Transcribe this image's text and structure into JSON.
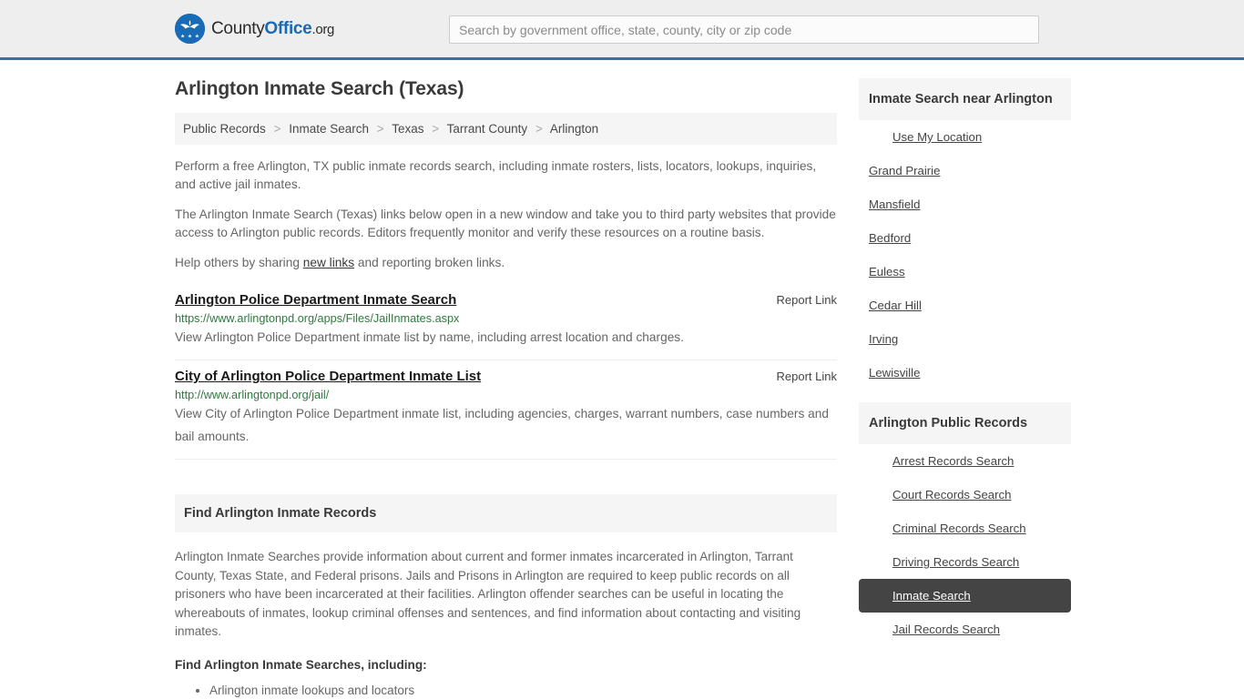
{
  "header": {
    "logo": {
      "icon": "eagle-seal-icon",
      "part1": "County",
      "part2": "Office",
      "part3": ".org"
    },
    "search": {
      "placeholder": "Search by government office, state, county, city or zip code",
      "value": "",
      "icon": "search-icon"
    },
    "accent_color": "#3a6ea5"
  },
  "main": {
    "title": "Arlington Inmate Search (Texas)",
    "breadcrumb": {
      "separator": ">",
      "items": [
        {
          "label": "Public Records"
        },
        {
          "label": "Inmate Search"
        },
        {
          "label": "Texas"
        },
        {
          "label": "Tarrant County"
        },
        {
          "label": "Arlington"
        }
      ]
    },
    "intro": {
      "p1": "Perform a free Arlington, TX public inmate records search, including inmate rosters, lists, locators, lookups, inquiries, and active jail inmates.",
      "p2": "The Arlington Inmate Search (Texas) links below open in a new window and take you to third party websites that provide access to Arlington public records. Editors frequently monitor and verify these resources on a routine basis.",
      "p3_before": "Help others by sharing ",
      "p3_link": "new links",
      "p3_after": " and reporting broken links."
    },
    "results": [
      {
        "title": "Arlington Police Department Inmate Search",
        "report_label": "Report Link",
        "url": "https://www.arlingtonpd.org/apps/Files/JailInmates.aspx",
        "description": "View Arlington Police Department inmate list by name, including arrest location and charges."
      },
      {
        "title": "City of Arlington Police Department Inmate List",
        "report_label": "Report Link",
        "url": "http://www.arlingtonpd.org/jail/",
        "description": "View City of Arlington Police Department inmate list, including agencies, charges, warrant numbers, case numbers and bail amounts."
      }
    ],
    "section": {
      "heading": "Find Arlington Inmate Records",
      "body": "Arlington Inmate Searches provide information about current and former inmates incarcerated in Arlington, Tarrant County, Texas State, and Federal prisons. Jails and Prisons in Arlington are required to keep public records on all prisoners who have been incarcerated at their facilities. Arlington offender searches can be useful in locating the whereabouts of inmates, lookup criminal offenses and sentences, and find information about contacting and visiting inmates.",
      "subheading": "Find Arlington Inmate Searches, including:",
      "bullets": [
        "Arlington inmate lookups and locators"
      ]
    }
  },
  "sidebar": {
    "nearby": {
      "heading": "Inmate Search near Arlington",
      "use_my_location": "Use My Location",
      "cities": [
        {
          "label": "Grand Prairie"
        },
        {
          "label": "Mansfield"
        },
        {
          "label": "Bedford"
        },
        {
          "label": "Euless"
        },
        {
          "label": "Cedar Hill"
        },
        {
          "label": "Irving"
        },
        {
          "label": "Lewisville"
        }
      ]
    },
    "public_records": {
      "heading": "Arlington Public Records",
      "active_label": "Inmate Search",
      "active_bg": "#444444",
      "items": [
        {
          "label": "Arrest Records Search",
          "active": false
        },
        {
          "label": "Court Records Search",
          "active": false
        },
        {
          "label": "Criminal Records Search",
          "active": false
        },
        {
          "label": "Driving Records Search",
          "active": false
        },
        {
          "label": "Inmate Search",
          "active": true
        },
        {
          "label": "Jail Records Search",
          "active": false
        }
      ]
    }
  }
}
